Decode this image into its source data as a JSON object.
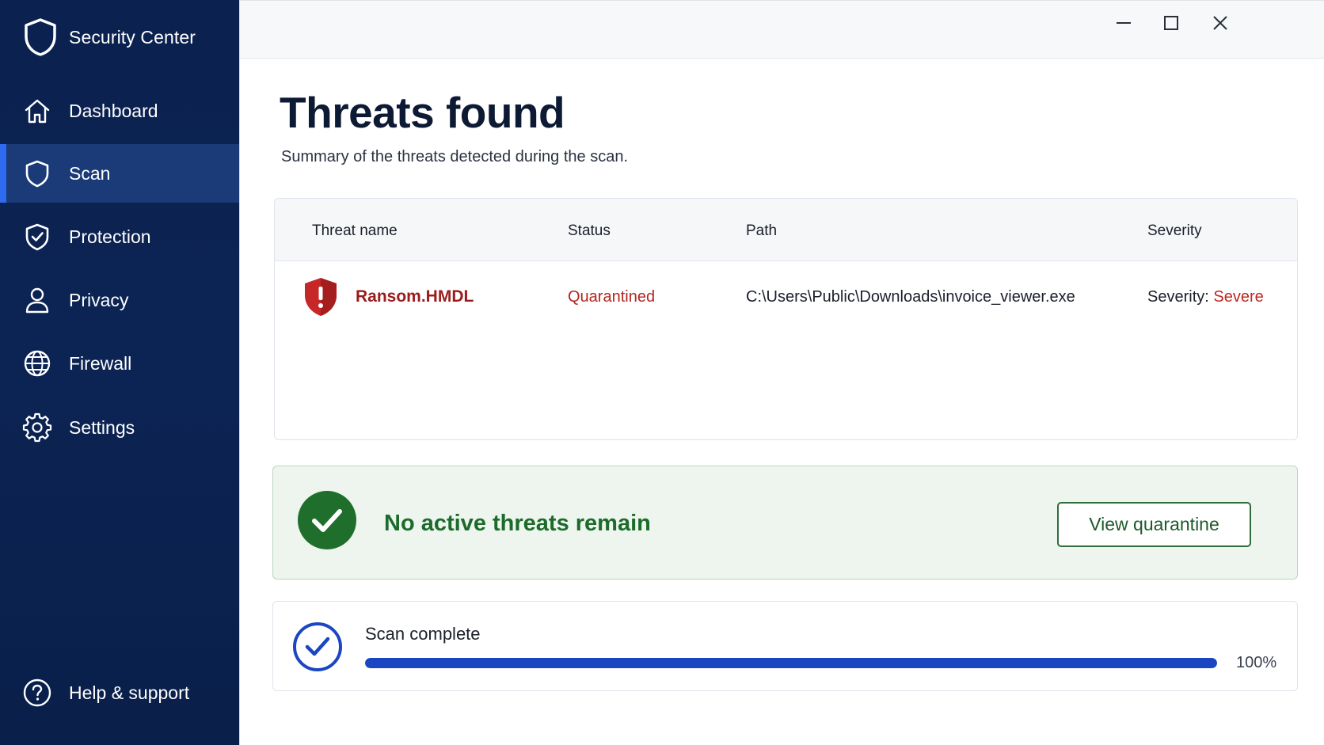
{
  "app": {
    "title": "Security Center"
  },
  "sidebar": {
    "items": [
      {
        "label": "Dashboard",
        "icon": "home-icon"
      },
      {
        "label": "Scan",
        "icon": "shield-icon",
        "active": true
      },
      {
        "label": "Protection",
        "icon": "shield-check-icon"
      },
      {
        "label": "Privacy",
        "icon": "person-icon"
      },
      {
        "label": "Firewall",
        "icon": "globe-icon"
      },
      {
        "label": "Settings",
        "icon": "gear-icon"
      }
    ],
    "help": {
      "label": "Help & support",
      "icon": "help-circle-icon"
    }
  },
  "window": {
    "controls": [
      "minimize-icon",
      "maximize-icon",
      "close-icon"
    ]
  },
  "page": {
    "title": "Threats found",
    "subtitle": "Summary of the threats detected during the scan."
  },
  "table": {
    "headers": {
      "name": "Threat name",
      "status": "Status",
      "path": "Path",
      "severity": "Severity"
    },
    "rows": [
      {
        "name": "Ransom.HMDL",
        "status": "Quarantined",
        "path": "C:\\Users\\Public\\Downloads\\invoice_viewer.exe",
        "severity_label": "Severity:",
        "severity_value": "Severe",
        "icon": "threat-shield-icon"
      }
    ]
  },
  "banner": {
    "text": "No active threats remain",
    "button": "View quarantine",
    "icon": "check-circle-icon"
  },
  "scan": {
    "label": "Scan complete",
    "progress_percent": 100,
    "progress_text": "100%",
    "icon": "check-circle-outline-icon"
  },
  "colors": {
    "sidebar_bg": "#0b2250",
    "active_item": "#1a3a78",
    "accent": "#2e6bf0",
    "danger": "#b3261e",
    "success": "#1d6b2b",
    "progress": "#1b46c2"
  }
}
